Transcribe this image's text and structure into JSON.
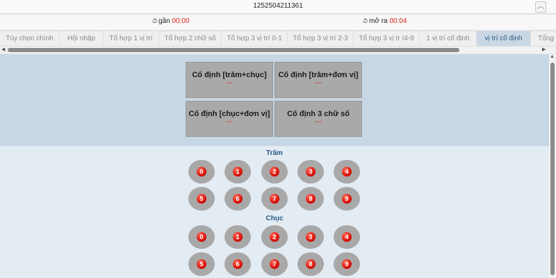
{
  "window": {
    "title": "1252504211361"
  },
  "timers": {
    "left": {
      "label": "gần",
      "value": "00:00"
    },
    "right": {
      "label": "mở ra",
      "value": "00:04"
    }
  },
  "tabs": [
    {
      "label": "Tùy chọn chính"
    },
    {
      "label": "Hội nhập"
    },
    {
      "label": "Tổ hợp 1 vị trí"
    },
    {
      "label": "Tổ hợp 2 chữ số"
    },
    {
      "label": "Tổ hợp 3 vị trí 0-1"
    },
    {
      "label": "Tổ hợp 3 vị trí 2-3"
    },
    {
      "label": "Tổ hợp 3 vị tr í4-9"
    },
    {
      "label": "1 vị trí cố định"
    },
    {
      "label": "vị trí cố định",
      "active": true
    },
    {
      "label": "Tổng"
    }
  ],
  "options": [
    {
      "label": "Cố định [trăm+chục]",
      "sub": "---"
    },
    {
      "label": "Cố định [trăm+đơn vị]",
      "sub": "---"
    },
    {
      "label": "Cố định [chục+đơn vị]",
      "sub": "---"
    },
    {
      "label": "Cố định 3 chữ số",
      "sub": "---"
    }
  ],
  "groups": [
    {
      "title": "Trăm",
      "digits": [
        "0",
        "1",
        "2",
        "3",
        "4",
        "5",
        "6",
        "7",
        "8",
        "9"
      ]
    },
    {
      "title": "Chục",
      "digits": [
        "0",
        "1",
        "2",
        "3",
        "4",
        "5",
        "6",
        "7",
        "8",
        "9"
      ]
    }
  ],
  "colors": {
    "accent_red": "#d9251c",
    "active_tab_bg": "#cad7e4",
    "group_title": "#2a5a86"
  }
}
